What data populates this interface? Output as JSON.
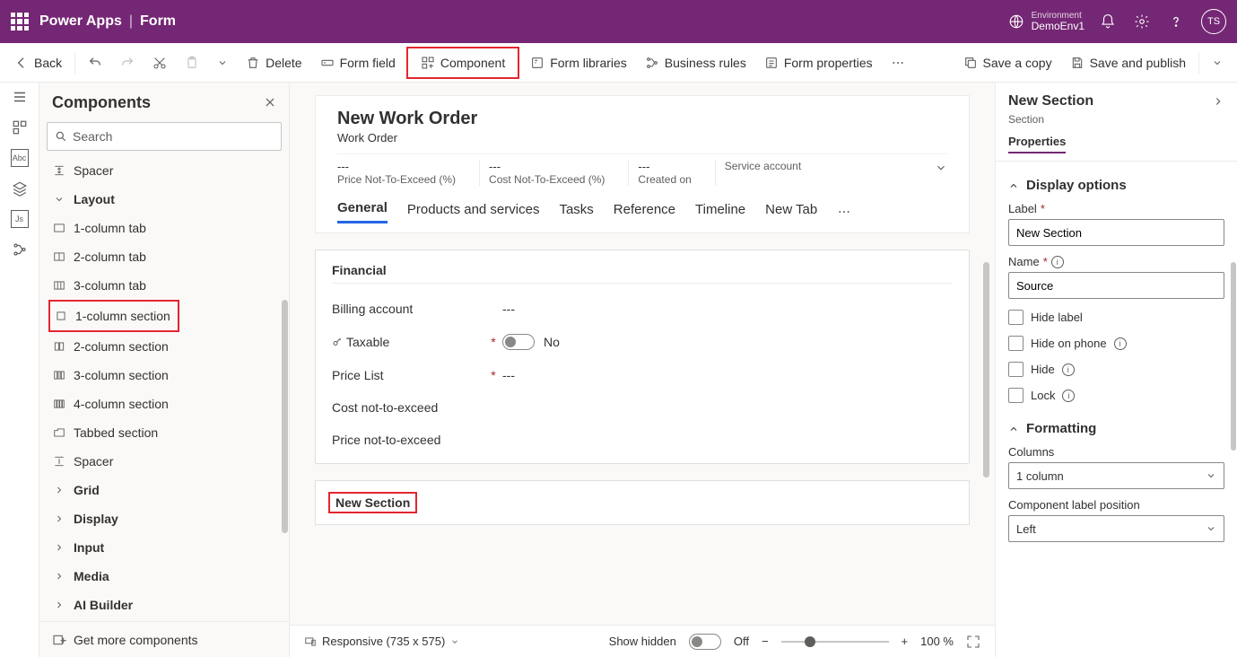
{
  "topbar": {
    "app": "Power Apps",
    "page": "Form",
    "env_label": "Environment",
    "env_name": "DemoEnv1",
    "avatar": "TS"
  },
  "cmd": {
    "back": "Back",
    "delete": "Delete",
    "form_field": "Form field",
    "component": "Component",
    "form_libraries": "Form libraries",
    "business_rules": "Business rules",
    "form_properties": "Form properties",
    "save_copy": "Save a copy",
    "save_publish": "Save and publish"
  },
  "components": {
    "title": "Components",
    "search_ph": "Search",
    "top_spacer": "Spacer",
    "group_layout": "Layout",
    "items": [
      "1-column tab",
      "2-column tab",
      "3-column tab",
      "1-column section",
      "2-column section",
      "3-column section",
      "4-column section",
      "Tabbed section",
      "Spacer"
    ],
    "collapsed": [
      "Grid",
      "Display",
      "Input",
      "Media",
      "AI Builder"
    ],
    "footer": "Get more components"
  },
  "form": {
    "title": "New Work Order",
    "subtitle": "Work Order",
    "header_fields": [
      {
        "v": "---",
        "l": "Price Not-To-Exceed (%)"
      },
      {
        "v": "---",
        "l": "Cost Not-To-Exceed (%)"
      },
      {
        "v": "---",
        "l": "Created on"
      },
      {
        "v": "",
        "l": "Service account"
      }
    ],
    "tabs": [
      "General",
      "Products and services",
      "Tasks",
      "Reference",
      "Timeline",
      "New Tab"
    ],
    "section_financial": "Financial",
    "fields": {
      "billing_account": {
        "label": "Billing account",
        "val": "---"
      },
      "taxable": {
        "label": "Taxable",
        "val": "No"
      },
      "price_list": {
        "label": "Price List",
        "val": "---"
      },
      "cost_nte": {
        "label": "Cost not-to-exceed"
      },
      "price_nte": {
        "label": "Price not-to-exceed"
      }
    },
    "new_section": "New Section"
  },
  "status": {
    "responsive": "Responsive (735 x 575)",
    "show_hidden": "Show hidden",
    "off": "Off",
    "zoom": "100 %"
  },
  "props": {
    "title": "New Section",
    "subtitle": "Section",
    "tab": "Properties",
    "display_options": "Display options",
    "label_label": "Label",
    "label_val": "New Section",
    "name_label": "Name",
    "name_val": "Source",
    "hide_label": "Hide label",
    "hide_phone": "Hide on phone",
    "hide": "Hide",
    "lock": "Lock",
    "formatting": "Formatting",
    "columns": "Columns",
    "columns_val": "1 column",
    "comp_label_pos": "Component label position",
    "comp_label_pos_val": "Left"
  }
}
